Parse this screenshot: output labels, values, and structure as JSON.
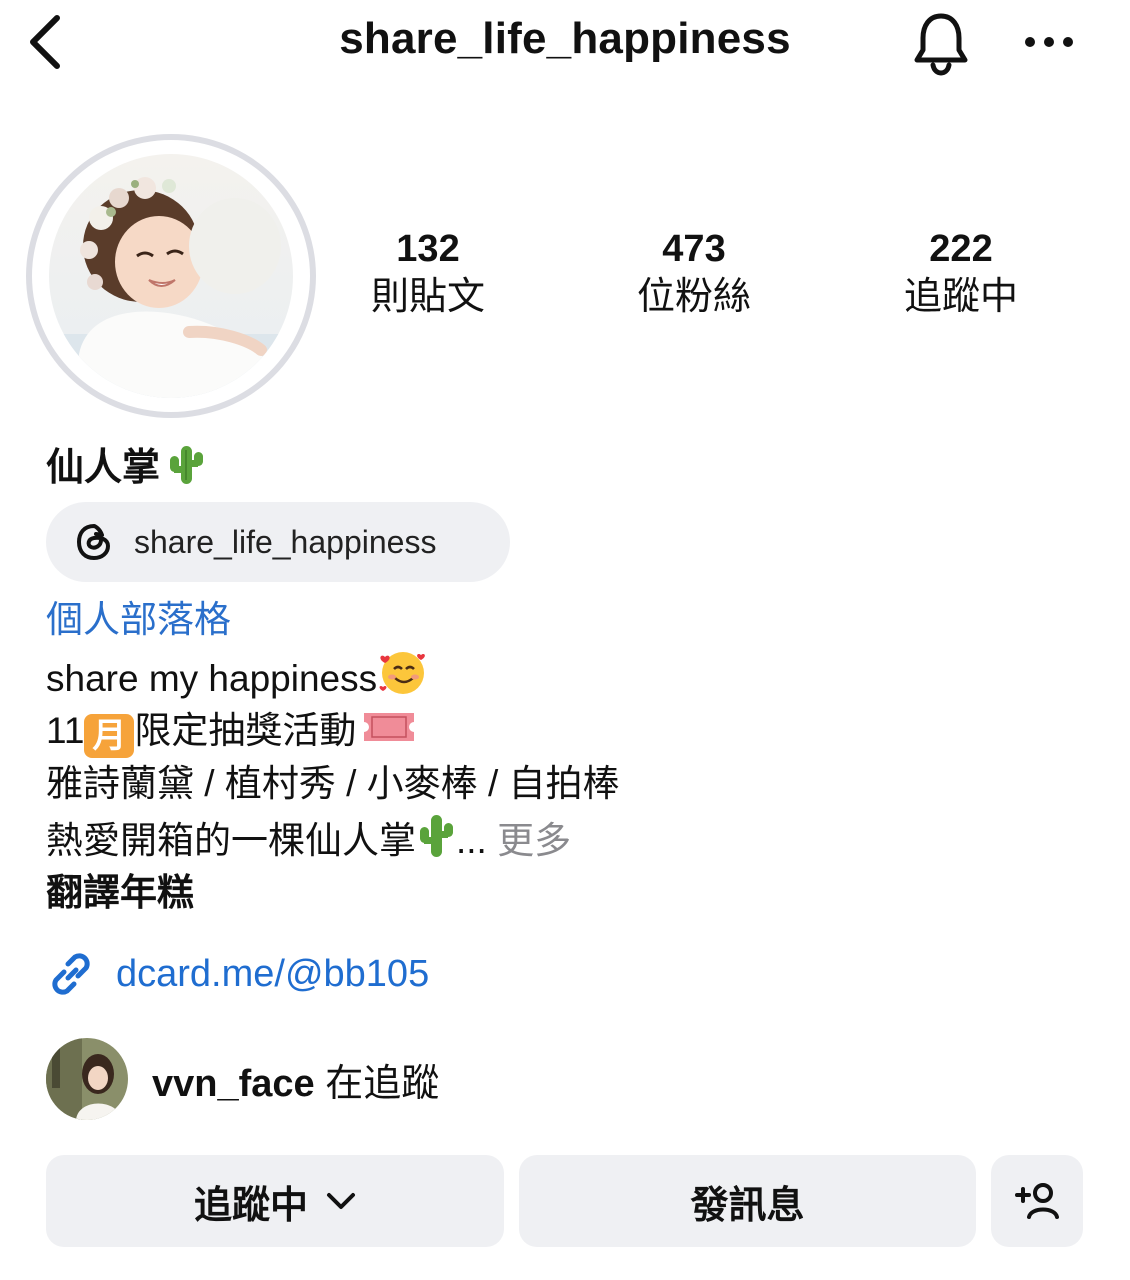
{
  "header": {
    "title": "share_life_happiness"
  },
  "stats": {
    "posts": {
      "count": "132",
      "label": "則貼文"
    },
    "followers": {
      "count": "473",
      "label": "位粉絲"
    },
    "following": {
      "count": "222",
      "label": "追蹤中"
    }
  },
  "profile": {
    "display_name": "仙人掌",
    "threads_handle": "share_life_happiness",
    "category": "個人部落格",
    "bio_lines": [
      "share my happiness",
      "11",
      "限定抽獎活動",
      "雅詩蘭黛 / 植村秀 / 小麥棒 / 自拍棒",
      "熱愛開箱的一棵仙人掌",
      "... ",
      "更多",
      "翻譯年糕"
    ],
    "link": "dcard.me/@bb105",
    "ticket_text": "ADMIT ONE",
    "month_char": "月"
  },
  "followed_by": {
    "username": "vvn_face",
    "suffix": " 在追蹤"
  },
  "actions": {
    "following_label": "追蹤中",
    "message_label": "發訊息",
    "add_user_glyph": "+"
  },
  "colors": {
    "link_blue": "#1f6dd0",
    "category_blue": "#2a6fcb",
    "button_bg": "#eff0f3",
    "ring": "#dcdde3"
  }
}
